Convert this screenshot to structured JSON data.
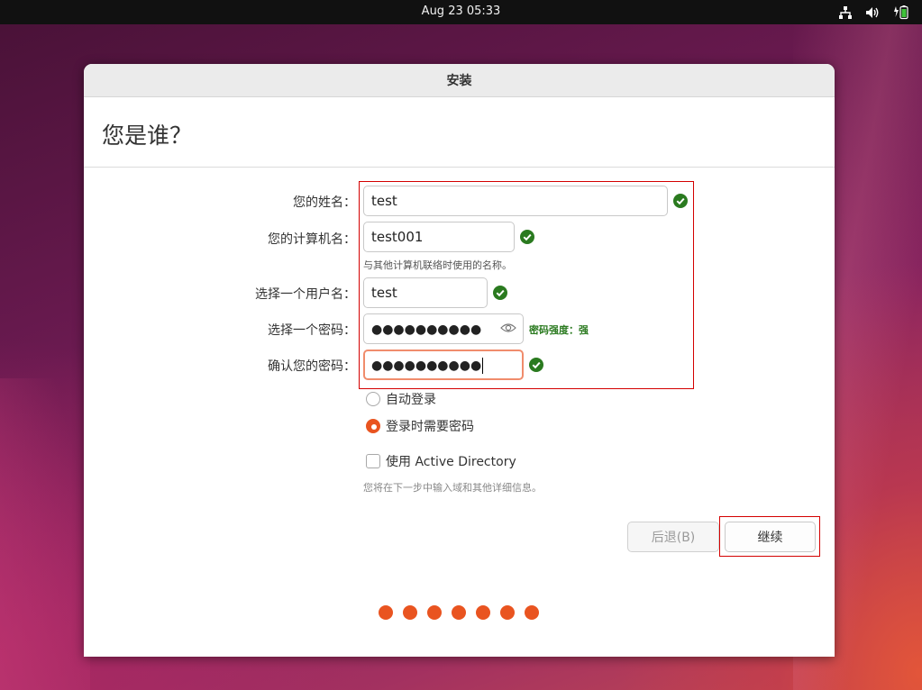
{
  "topbar": {
    "clock": "Aug 23  05:33",
    "icons": [
      "network-icon",
      "volume-icon",
      "battery-icon"
    ]
  },
  "window": {
    "title": "安装",
    "heading": "您是谁？"
  },
  "form": {
    "name_label": "您的姓名：",
    "name_value": "test",
    "computer_label": "您的计算机名：",
    "computer_value": "test001",
    "computer_hint": "与其他计算机联络时使用的名称。",
    "username_label": "选择一个用户名：",
    "username_value": "test",
    "password_label": "选择一个密码：",
    "password_value": "●●●●●●●●●●",
    "password_strength": "密码强度：强",
    "confirm_label": "确认您的密码：",
    "confirm_value": "●●●●●●●●●●"
  },
  "login_options": {
    "auto_login": "自动登录",
    "require_password": "登录时需要密码",
    "selected": "require_password"
  },
  "active_directory": {
    "label": "使用 Active Directory",
    "checked": false,
    "hint": "您将在下一步中输入域和其他详细信息。"
  },
  "buttons": {
    "back": "后退(B)",
    "continue": "继续"
  },
  "progress": {
    "total_steps": 7
  },
  "colors": {
    "accent": "#E95420",
    "success": "#2A7A1F",
    "highlight": "#D40000"
  }
}
